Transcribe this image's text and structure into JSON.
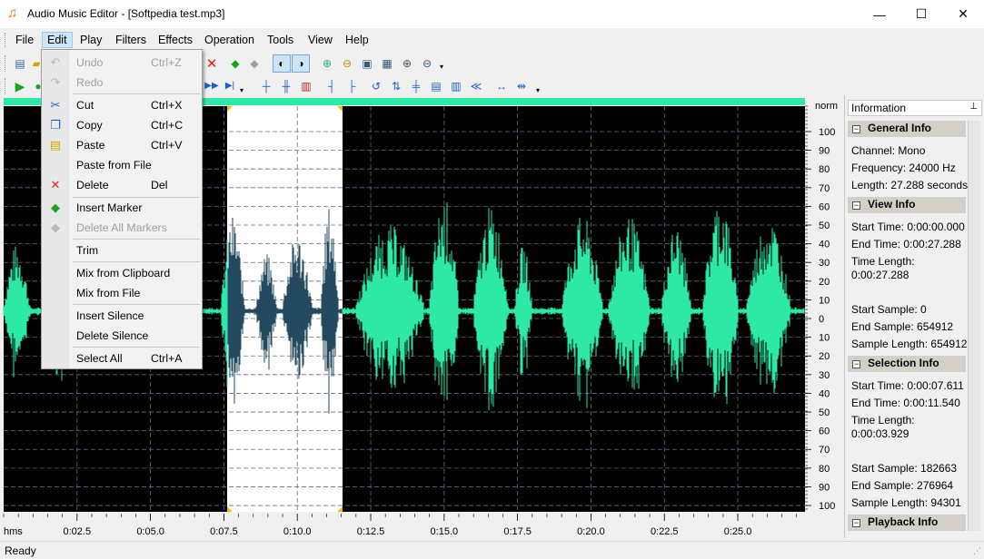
{
  "window": {
    "title": "Audio Music Editor - [Softpedia test.mp3]",
    "minimize": "—",
    "maximize": "☐",
    "close": "✕"
  },
  "menu": [
    "File",
    "Edit",
    "Play",
    "Filters",
    "Effects",
    "Operation",
    "Tools",
    "View",
    "Help"
  ],
  "edit_menu": {
    "items": [
      {
        "label": "Undo",
        "shortcut": "Ctrl+Z",
        "icon": "undo-icon",
        "enabled": false
      },
      {
        "label": "Redo",
        "shortcut": "",
        "icon": "redo-icon",
        "enabled": false
      },
      {
        "label": "Cut",
        "shortcut": "Ctrl+X",
        "icon": "scissors-icon",
        "enabled": true
      },
      {
        "label": "Copy",
        "shortcut": "Ctrl+C",
        "icon": "copy-icon",
        "enabled": true
      },
      {
        "label": "Paste",
        "shortcut": "Ctrl+V",
        "icon": "paste-icon",
        "enabled": true
      },
      {
        "label": "Paste from File",
        "shortcut": "",
        "icon": "",
        "enabled": true
      },
      {
        "label": "Delete",
        "shortcut": "Del",
        "icon": "delete-x-icon",
        "enabled": true
      },
      {
        "label": "Insert Marker",
        "shortcut": "",
        "icon": "insert-marker-icon",
        "enabled": true
      },
      {
        "label": "Delete All Markers",
        "shortcut": "",
        "icon": "delete-markers-icon",
        "enabled": false
      },
      {
        "label": "Trim",
        "shortcut": "",
        "icon": "",
        "enabled": true
      },
      {
        "label": "Mix from Clipboard",
        "shortcut": "",
        "icon": "",
        "enabled": true
      },
      {
        "label": "Mix from File",
        "shortcut": "",
        "icon": "",
        "enabled": true
      },
      {
        "label": "Insert Silence",
        "shortcut": "",
        "icon": "",
        "enabled": true
      },
      {
        "label": "Delete Silence",
        "shortcut": "",
        "icon": "",
        "enabled": true
      },
      {
        "label": "Select All",
        "shortcut": "Ctrl+A",
        "icon": "",
        "enabled": true
      }
    ]
  },
  "waveform": {
    "norm_label": "norm",
    "db_labels": [
      "100",
      "90",
      "80",
      "70",
      "60",
      "50",
      "40",
      "30",
      "20",
      "10",
      "0",
      "10",
      "20",
      "30",
      "40",
      "50",
      "60",
      "70",
      "80",
      "90",
      "100"
    ],
    "time_unit": "hms",
    "time_labels": [
      "0:02.5",
      "0:05.0",
      "0:07.5",
      "0:10.0",
      "0:12.5",
      "0:15.0",
      "0:17.5",
      "0:20.0",
      "0:22.5",
      "0:25.0"
    ],
    "total_seconds": 27.288,
    "selection_start_seconds": 7.611,
    "selection_end_seconds": 11.54,
    "wave_color": "#2ee8a6",
    "selected_wave_color": "#234a5e",
    "background_color": "#000000"
  },
  "info_panel": {
    "title": "Information",
    "pin_icon": "pin-icon",
    "general": {
      "header": "General Info",
      "lines": [
        "Channel: Mono",
        "Frequency: 24000 Hz",
        "Length: 27.288 seconds"
      ]
    },
    "view": {
      "header": "View Info",
      "lines": [
        "Start Time: 0:00:00.000",
        "End Time: 0:00:27.288",
        "Time Length:",
        "0:00:27.288",
        "Start Sample: 0",
        "End Sample: 654912",
        "Sample Length: 654912"
      ]
    },
    "selection": {
      "header": "Selection Info",
      "lines": [
        "Start Time: 0:00:07.611",
        "End Time: 0:00:11.540",
        "Time Length:",
        "0:00:03.929",
        "Start Sample: 182663",
        "End Sample: 276964",
        "Sample Length: 94301"
      ]
    },
    "playback": {
      "header": "Playback Info"
    }
  },
  "status": "Ready"
}
